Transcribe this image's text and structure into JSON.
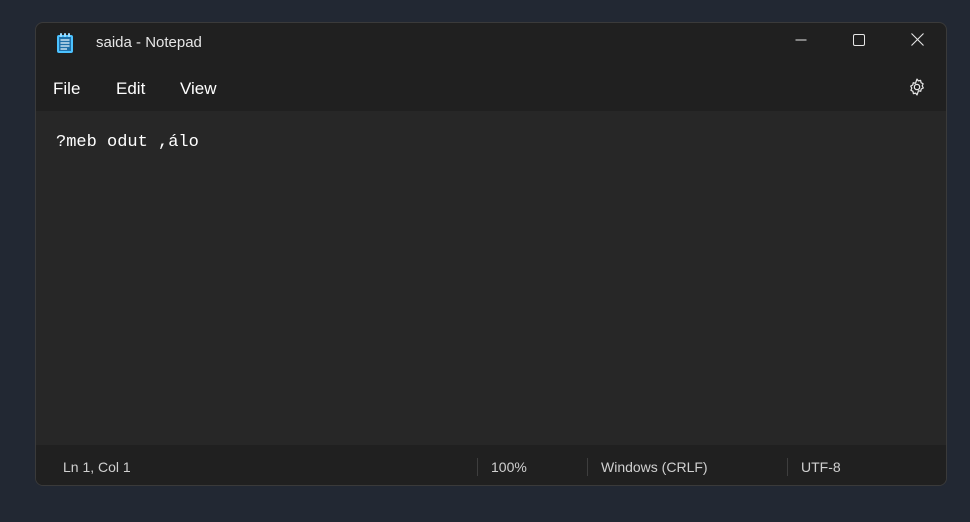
{
  "window": {
    "title": "saida - Notepad"
  },
  "icons": {
    "app": "notepad-icon",
    "minimize": "minimize-icon",
    "maximize": "maximize-icon",
    "close": "close-icon",
    "settings": "gear-icon"
  },
  "menu": {
    "file": "File",
    "edit": "Edit",
    "view": "View"
  },
  "editor": {
    "content": "?meb odut ,álo"
  },
  "status": {
    "position": "Ln 1, Col 1",
    "zoom": "100%",
    "line_endings": "Windows (CRLF)",
    "encoding": "UTF-8"
  },
  "colors": {
    "desktop": "#222833",
    "window_bg": "#202020",
    "editor_bg": "#272727",
    "text": "#ffffff",
    "icon_accent": "#4cc2ff"
  }
}
